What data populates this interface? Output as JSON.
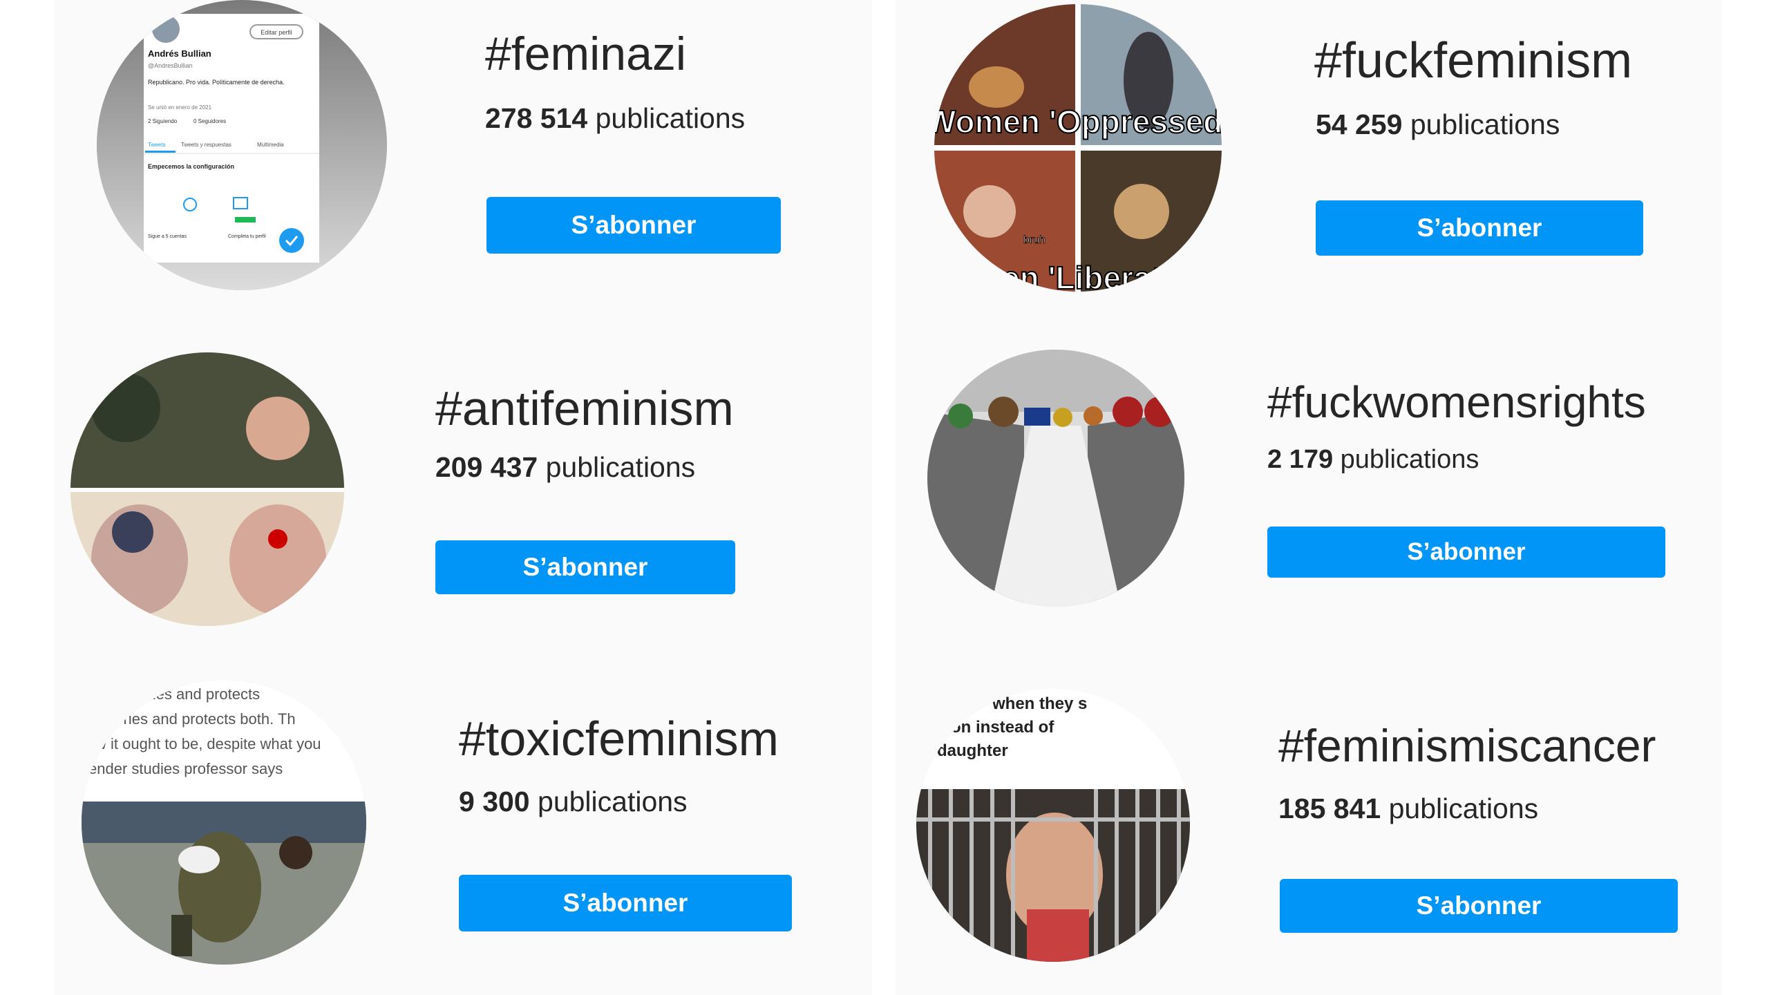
{
  "cards": [
    {
      "tag": "#feminazi",
      "count": "278 514",
      "unit": "publications",
      "button": "S’abonner",
      "thumb": {
        "profile_name": "Andrés Bullian",
        "handle": "@AndresBullian",
        "edit_label": "Editar perfil",
        "bio": "Republicano. Pro vida. Políticamente de derecha.",
        "joined": "Se unió en enero de 2021",
        "following": "2 Siguiendo",
        "followers": "0 Seguidores",
        "tabs": [
          "Tweets",
          "Tweets y respuestas",
          "Multimedia"
        ],
        "setup": "Empecemos la configuración",
        "left_action": "Sigue a 5 cuentas",
        "right_action": "Completa tu perfil"
      }
    },
    {
      "tag": "#fuckfeminism",
      "count": "54 259",
      "unit": "publications",
      "button": "S’abonner",
      "thumb": {
        "caption_top": "Women 'Oppressed'",
        "caption_mid": "bruh",
        "caption_bottom": "Women 'Liberated'"
      }
    },
    {
      "tag": "#antifeminism",
      "count": "209 437",
      "unit": "publications",
      "button": "S’abonner"
    },
    {
      "tag": "#fuckwomensrights",
      "count": "2 179",
      "unit": "publications",
      "button": "S’abonner"
    },
    {
      "tag": "#toxicfeminism",
      "count": "9 300",
      "unit": "publications",
      "button": "S’abonner",
      "thumb": {
        "lines": [
          "cradles and protects",
          "carries and protects both. Th",
          "w it ought to be, despite what you",
          "ender studies professor says"
        ]
      }
    },
    {
      "tag": "#feminismiscancer",
      "count": "185 841",
      "unit": "publications",
      "button": "S’abonner",
      "thumb": {
        "lines": [
          "when they s",
          "on instead of",
          "daughter"
        ]
      }
    }
  ],
  "colors": {
    "button": "#0095f6",
    "text": "#262626",
    "panel": "#fafafa"
  }
}
